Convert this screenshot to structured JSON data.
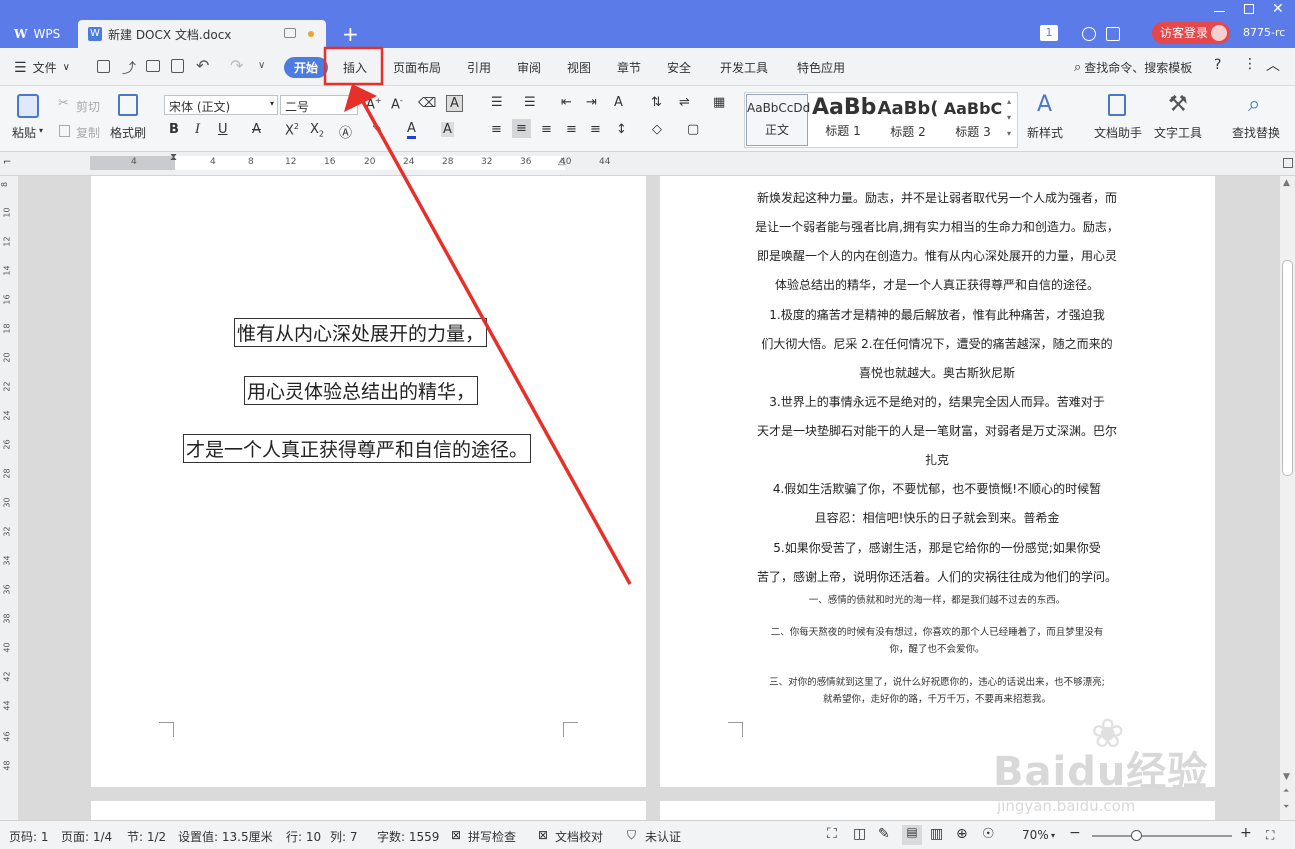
{
  "titlebar": {
    "app_tab": "WPS",
    "doc_tab": "新建 DOCX 文档.docx",
    "new_tab": "+",
    "tab_count": "1",
    "login": "访客登录",
    "version": "8775-rc"
  },
  "menu": {
    "file": "文件",
    "items": [
      "开始",
      "插入",
      "页面布局",
      "引用",
      "审阅",
      "视图",
      "章节",
      "安全",
      "开发工具",
      "特色应用"
    ],
    "search": "查找命令、搜索模板",
    "help": "?"
  },
  "ribbon": {
    "paste": "粘贴",
    "cut": "剪切",
    "copy": "复制",
    "format_painter": "格式刷",
    "font_name": "宋体 (正文)",
    "font_size": "二号",
    "styles": [
      {
        "sample": "AaBbCcDd",
        "label": "正文"
      },
      {
        "sample": "AaBb",
        "label": "标题 1"
      },
      {
        "sample": "AaBb(",
        "label": "标题 2"
      },
      {
        "sample": "AaBbC",
        "label": "标题 3"
      }
    ],
    "new_style": "新样式",
    "doc_helper": "文档助手",
    "text_tools": "文字工具",
    "find_replace": "查找替换"
  },
  "ruler": {
    "h_ticks": [
      "4",
      "4",
      "8",
      "12",
      "16",
      "20",
      "24",
      "28",
      "32",
      "36",
      "40",
      "44"
    ],
    "v_ticks": [
      "8",
      "10",
      "12",
      "14",
      "16",
      "18",
      "20",
      "22",
      "24",
      "26",
      "28",
      "30",
      "32",
      "34",
      "36",
      "38",
      "40",
      "42",
      "44",
      "46",
      "48"
    ]
  },
  "page_left": {
    "lines": [
      "惟有从内心深处展开的力量，",
      "用心灵体验总结出的精华，",
      "才是一个人真正获得尊严和自信的途径。"
    ]
  },
  "page_right": {
    "lines": [
      "新焕发起这种力量。励志，并不是让弱者取代另一个人成为强者，而",
      "是让一个弱者能与强者比肩,拥有实力相当的生命力和创造力。励志，",
      "即是唤醒一个人的内在创造力。惟有从内心深处展开的力量，用心灵",
      "体验总结出的精华，才是一个人真正获得尊严和自信的途径。",
      "1.极度的痛苦才是精神的最后解放者，惟有此种痛苦，才强迫我",
      "们大彻大悟。尼采 2.在任何情况下，遭受的痛苦越深，随之而来的",
      "喜悦也就越大。奥古斯狄尼斯",
      "3.世界上的事情永远不是绝对的，结果完全因人而异。苦难对于",
      "天才是一块垫脚石对能干的人是一笔财富，对弱者是万丈深渊。巴尔",
      "扎克",
      "4.假如生活欺骗了你，不要忧郁，也不要愤慨!不顺心的时候暂",
      "且容忍：相信吧!快乐的日子就会到来。普希金",
      "5.如果你受苦了，感谢生活，那是它给你的一份感觉;如果你受",
      "苦了，感谢上帝，说明你还活着。人们的灾祸往往成为他们的学问。"
    ],
    "small_lines": [
      "一、感情的债就和时光的海一样，都是我们越不过去的东西。",
      "二、你每天熬夜的时候有没有想过，你喜欢的那个人已经睡着了，而且梦里没有",
      "你，醒了也不会爱你。",
      "三、对你的感情就到这里了，说什么好祝愿你的，违心的话说出来，也不够漂亮;",
      "就希望你，走好你的路，千万千万，不要再来招惹我。"
    ]
  },
  "watermark": {
    "brand": "Baidu经验",
    "url": "jingyan.baidu.com"
  },
  "status": {
    "page_no": "页码: 1",
    "pages": "页面: 1/4",
    "section": "节: 1/2",
    "setting": "设置值: 13.5厘米",
    "row": "行: 10",
    "col": "列: 7",
    "words": "字数: 1559",
    "spell": "拼写检查",
    "proof": "文档校对",
    "cert": "未认证",
    "zoom": "70%"
  },
  "colors": {
    "titlebar": "#5b7be8",
    "active_tab": "#4d7ce0",
    "highlight": "#e8302a"
  }
}
